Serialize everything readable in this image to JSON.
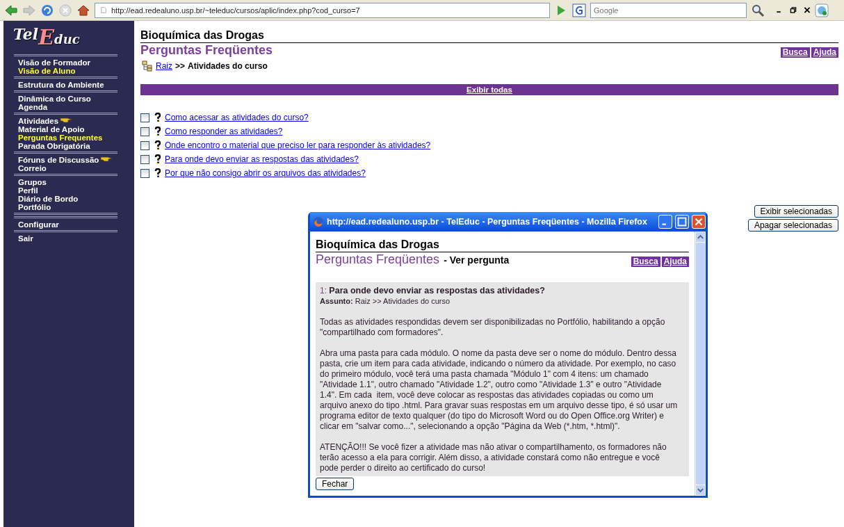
{
  "browser": {
    "url": "http://ead.redealuno.usp.br/~teleduc/cursos/aplic/index.php?cod_curso=7",
    "search_placeholder": "Google"
  },
  "sidebar": {
    "logo": {
      "part1": "Tel",
      "part2": "E",
      "part3": "duc"
    },
    "groups": [
      {
        "items": [
          {
            "label": "Visão de Formador",
            "selected": false,
            "pointer": false
          },
          {
            "label": "Visão de Aluno",
            "selected": true,
            "pointer": false
          }
        ]
      },
      {
        "items": [
          {
            "label": "Estrutura do Ambiente",
            "selected": false,
            "pointer": false
          }
        ]
      },
      {
        "items": [
          {
            "label": "Dinâmica do Curso",
            "selected": false,
            "pointer": false
          },
          {
            "label": "Agenda",
            "selected": false,
            "pointer": false
          }
        ]
      },
      {
        "items": [
          {
            "label": "Atividades",
            "selected": false,
            "pointer": true
          },
          {
            "label": "Material de Apoio",
            "selected": false,
            "pointer": false
          },
          {
            "label": "Perguntas Frequentes",
            "selected": true,
            "pointer": false
          },
          {
            "label": "Parada Obrigatória",
            "selected": false,
            "pointer": false
          }
        ]
      },
      {
        "items": [
          {
            "label": "Fóruns de Discussão",
            "selected": false,
            "pointer": true
          },
          {
            "label": "Correio",
            "selected": false,
            "pointer": false
          }
        ]
      },
      {
        "items": [
          {
            "label": "Grupos",
            "selected": false,
            "pointer": false
          },
          {
            "label": "Perfil",
            "selected": false,
            "pointer": false
          },
          {
            "label": "Diário de Bordo",
            "selected": false,
            "pointer": false
          },
          {
            "label": "Portfólio",
            "selected": false,
            "pointer": false
          }
        ]
      },
      {
        "double_rule": true,
        "items": [
          {
            "label": "Configurar",
            "selected": false,
            "pointer": false
          }
        ]
      },
      {
        "items": [
          {
            "label": "Sair",
            "selected": false,
            "pointer": false
          }
        ]
      }
    ]
  },
  "page": {
    "course_title": "Bioquímica das Drogas",
    "section_title": "Perguntas Freqüentes",
    "header_buttons": [
      "Busca",
      "Ajuda"
    ],
    "breadcrumb": {
      "root": "Raiz",
      "separator": ">>",
      "current": "Atividades do curso"
    },
    "show_all": "Exibir todas",
    "questions": [
      {
        "text": "Como acessar as atividades do curso?",
        "checked": false
      },
      {
        "text": "Como responder as atividades?",
        "checked": false
      },
      {
        "text": "Onde encontro o material que preciso ler para responder às atividades?",
        "checked": false
      },
      {
        "text": "Para onde devo enviar as respostas das atividades?",
        "checked": false
      },
      {
        "text": "Por que não consigo abrir os arquivos das atividades?",
        "checked": false
      }
    ],
    "actions": [
      "Exibir selecionadas",
      "Apagar selecionadas"
    ]
  },
  "popup": {
    "title": "http://ead.redealuno.usp.br - TelEduc - Perguntas Freqüentes - Mozilla Firefox",
    "course_title": "Bioquímica das Drogas",
    "section_title": "Perguntas Freqüentes",
    "subtitle": "- Ver pergunta",
    "header_buttons": [
      "Busca",
      "Ajuda"
    ],
    "question_number": "1:",
    "question": "Para onde devo enviar as respostas das atividades?",
    "subject_label": "Assunto:",
    "subject": "Raiz >> Atividades do curso",
    "paragraphs": [
      "Todas as atividades respondidas devem ser disponibilizadas no Portfólio, habilitando a opção \"compartilhado com formadores\".",
      "Abra uma pasta para cada módulo. O nome da pasta deve ser o nome do módulo. Dentro dessa pasta, crie um item para cada atividade, indicando o número da atividade. Por exemplo, no caso do primeiro módulo, você terá uma pasta chamada \"Módulo 1\" com 4 itens: um chamado \"Atividade 1.1\", outro chamado \"Atividade 1.2\", outro como \"Atividade 1.3\" e outro \"Atividade 1.4\". Em cada  item, você deve colocar as respostas das atividades copiadas ou como um arquivo anexo do tipo .html. Para gravar suas respostas em um arquivo desse tipo, é só usar um programa editor de texto qualquer (do tipo do Microsoft Word ou do Open Office.org Writer) e clicar em \"salvar como...\", selecionando a opção \"Página da Web (*.htm, *.html)\".",
      "ATENÇÃO!!! Se você fizer a atividade mas não ativar o compartilhamento, os formadores não terão acesso a ela para corrigir. Além disso, a atividade constará como não entregue e você pode perder o direito ao certificado do curso!"
    ],
    "close_button": "Fechar"
  }
}
